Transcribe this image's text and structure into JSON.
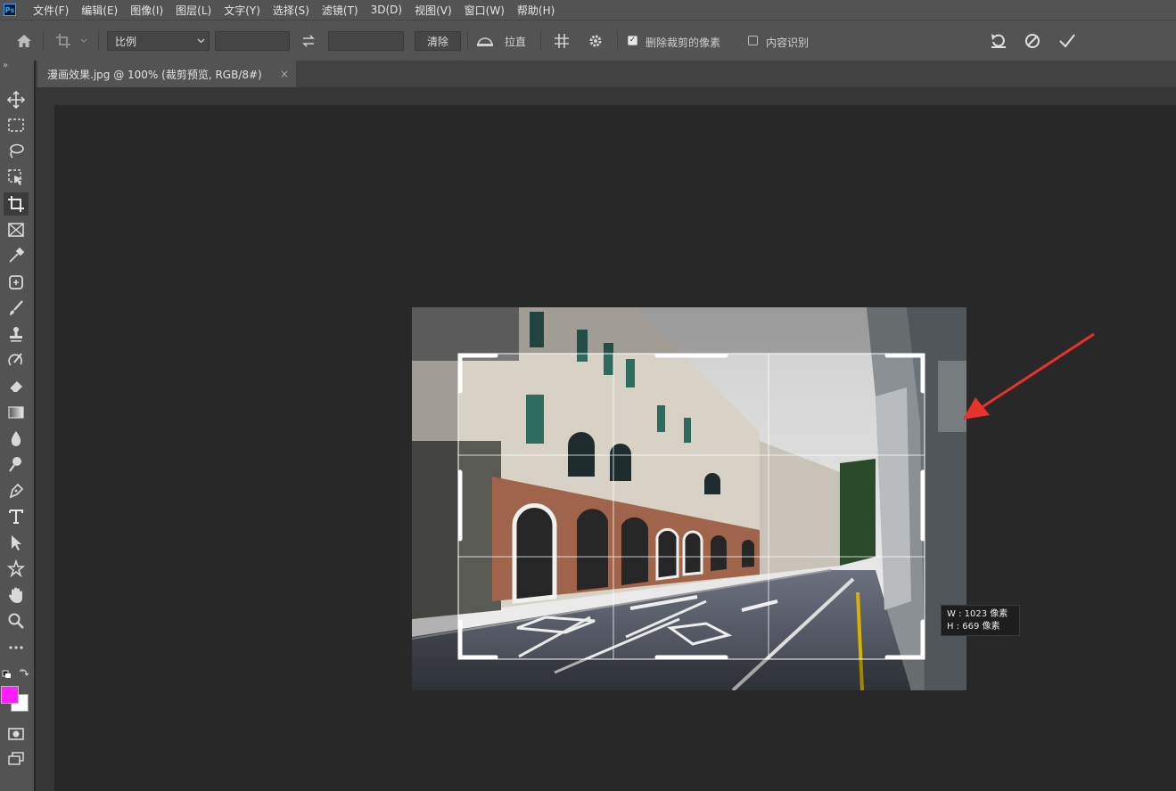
{
  "menubar": {
    "logo": "Ps",
    "items": [
      "文件(F)",
      "编辑(E)",
      "图像(I)",
      "图层(L)",
      "文字(Y)",
      "选择(S)",
      "滤镜(T)",
      "3D(D)",
      "视图(V)",
      "窗口(W)",
      "帮助(H)"
    ]
  },
  "options": {
    "ratio_select": "比例",
    "clear_label": "清除",
    "straighten_label": "拉直",
    "delete_cropped_label": "删除裁剪的像素",
    "delete_cropped_checked": true,
    "content_aware_label": "内容识别",
    "content_aware_checked": false
  },
  "document": {
    "tab_title": "漫画效果.jpg @ 100% (裁剪预览, RGB/8#)",
    "tab_close": "×"
  },
  "toolbar": {
    "expand": "»",
    "foreground_color": "#ff1eff",
    "background_color": "#ffffff"
  },
  "crop_tooltip": {
    "width_line": "W : 1023 像素",
    "height_line": "H :  669 像素"
  },
  "annotation": {
    "arrow_color": "#e8322b"
  }
}
